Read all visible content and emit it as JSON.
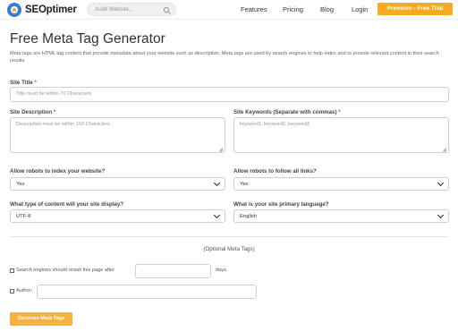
{
  "header": {
    "logo_text": "SEOptimer",
    "search_placeholder": "Audit Website...",
    "nav": [
      "Features",
      "Pricing",
      "Blog",
      "Login"
    ],
    "premium_label": "Premium - Free Trial",
    "accent_color": "#f7a922"
  },
  "main": {
    "title": "Free Meta Tag Generator",
    "subtitle": "Meta tags are HTML tag content that provide metadata about your website such as description. Meta tags are used by search engines to help index and to provide relevant content in their search results",
    "site_title": {
      "label": "Site Title",
      "required_mark": "*",
      "placeholder": "Title must be within 70 Characters"
    },
    "site_description": {
      "label": "Site Description",
      "required_mark": "*",
      "placeholder": "Description must be within 150 Characters"
    },
    "site_keywords": {
      "label": "Site Keywords (Separate with commas)",
      "required_mark": "*",
      "placeholder": "keyword1, keyword2, keyword3"
    },
    "robots_index": {
      "label": "Allow robots to index your website?",
      "value": "Yes"
    },
    "robots_follow": {
      "label": "Allow robots to follow all links?",
      "value": "Yes"
    },
    "content_type": {
      "label": "What type of content will your site display?",
      "value": "UTF-8"
    },
    "language": {
      "label": "What is your site primary language?",
      "value": "English"
    },
    "optional_heading": "(Optional Meta Tags)",
    "revisit": {
      "label": "Search engines should revisit this page after",
      "value": "",
      "suffix": "days."
    },
    "author": {
      "label": "Author:",
      "value": ""
    },
    "generate_label": "Generate Meta Tags"
  }
}
